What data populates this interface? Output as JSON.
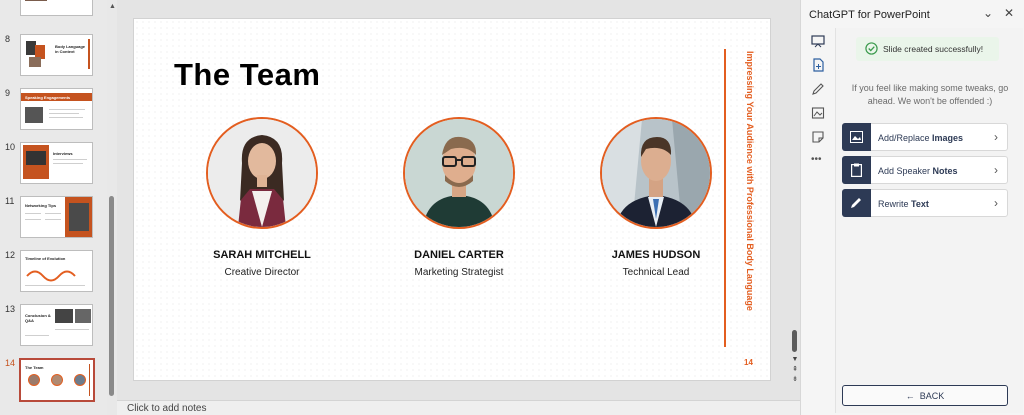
{
  "thumbnails": [
    {
      "num": "8",
      "title": "Body Language in Context"
    },
    {
      "num": "9",
      "title": "Speaking Engagements"
    },
    {
      "num": "10",
      "title": "Interviews"
    },
    {
      "num": "11",
      "title": "Networking Tips"
    },
    {
      "num": "12",
      "title": "Timeline of Evolution"
    },
    {
      "num": "13",
      "title": "Conclusion & Q&A"
    },
    {
      "num": "14",
      "title": "The Team"
    }
  ],
  "slide": {
    "title": "The Team",
    "side_text": "Impressing Your Audience with Professional Body Language",
    "page_number": "14",
    "members": [
      {
        "name": "SARAH MITCHELL",
        "role": "Creative Director"
      },
      {
        "name": "DANIEL CARTER",
        "role": "Marketing Strategist"
      },
      {
        "name": "JAMES HUDSON",
        "role": "Technical Lead"
      }
    ]
  },
  "notes_placeholder": "Click to add notes",
  "panel": {
    "title": "ChatGPT for PowerPoint",
    "success": "Slide created successfully!",
    "hint": "If you feel like making some tweaks, go ahead. We won't be offended :)",
    "actions": [
      {
        "prefix": "Add/Replace ",
        "bold": "Images"
      },
      {
        "prefix": "Add Speaker ",
        "bold": "Notes"
      },
      {
        "prefix": "Rewrite ",
        "bold": "Text"
      }
    ],
    "back_label": "BACK"
  },
  "colors": {
    "accent": "#e35e20",
    "navy": "#2d3a55",
    "success_bg": "#eaf5ea"
  }
}
